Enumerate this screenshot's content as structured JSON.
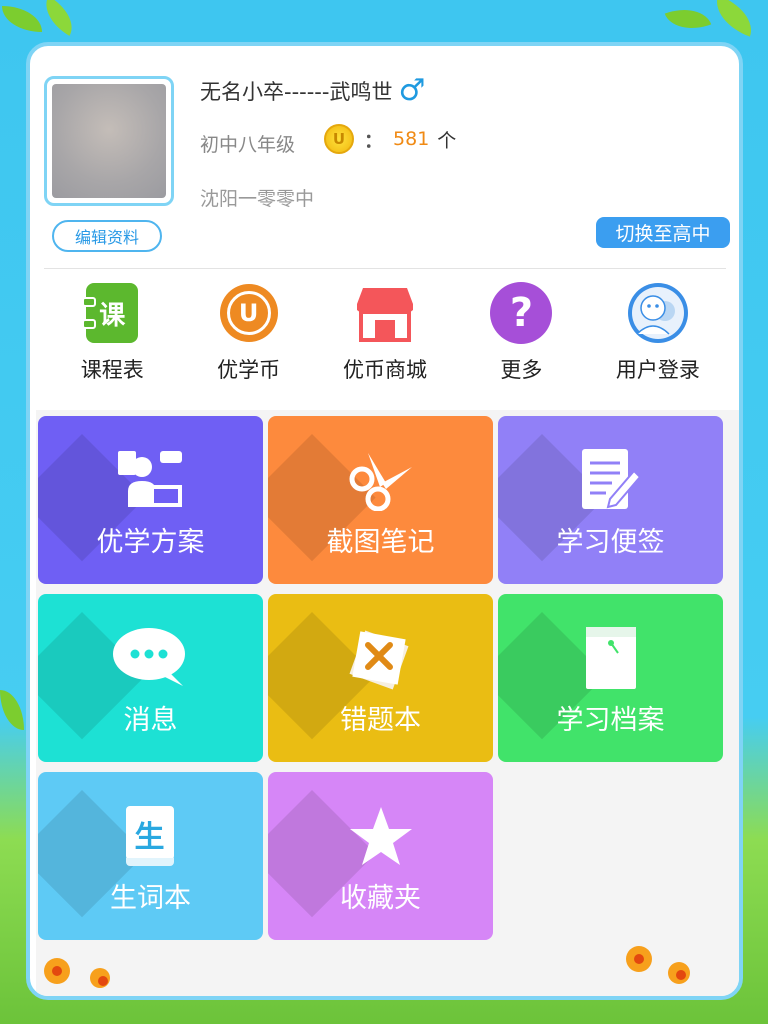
{
  "profile": {
    "username": "无名小卒------武鸣世",
    "gender_icon": "male-icon",
    "grade": "初中八年级",
    "coin_count": "581",
    "coin_unit": "个",
    "coin_symbol": "U",
    "coin_separator": "：",
    "school": "沈阳一零零中",
    "edit_label": "编辑资料",
    "switch_label": "切换至高中"
  },
  "quick_menu": [
    {
      "label": "课程表",
      "icon": "schedule-icon",
      "glyph": "课"
    },
    {
      "label": "优学币",
      "icon": "coin-icon",
      "glyph": "U"
    },
    {
      "label": "优币商城",
      "icon": "shop-icon"
    },
    {
      "label": "更多",
      "icon": "help-icon",
      "glyph": "?"
    },
    {
      "label": "用户登录",
      "icon": "user-icon"
    }
  ],
  "tiles": [
    {
      "label": "优学方案",
      "icon": "study-plan-icon",
      "color": "#6f5ff4"
    },
    {
      "label": "截图笔记",
      "icon": "scissors-icon",
      "color": "#fd8a3d"
    },
    {
      "label": "学习便签",
      "icon": "notepad-icon",
      "color": "#9180f7"
    },
    {
      "label": "消息",
      "icon": "message-icon",
      "color": "#1de1d4"
    },
    {
      "label": "错题本",
      "icon": "wrong-book-icon",
      "color": "#eabd13"
    },
    {
      "label": "学习档案",
      "icon": "archive-icon",
      "color": "#41e36a"
    },
    {
      "label": "生词本",
      "icon": "vocabulary-icon",
      "color": "#5ecaf5",
      "glyph": "生"
    },
    {
      "label": "收藏夹",
      "icon": "star-icon",
      "color": "#d686f7"
    }
  ]
}
